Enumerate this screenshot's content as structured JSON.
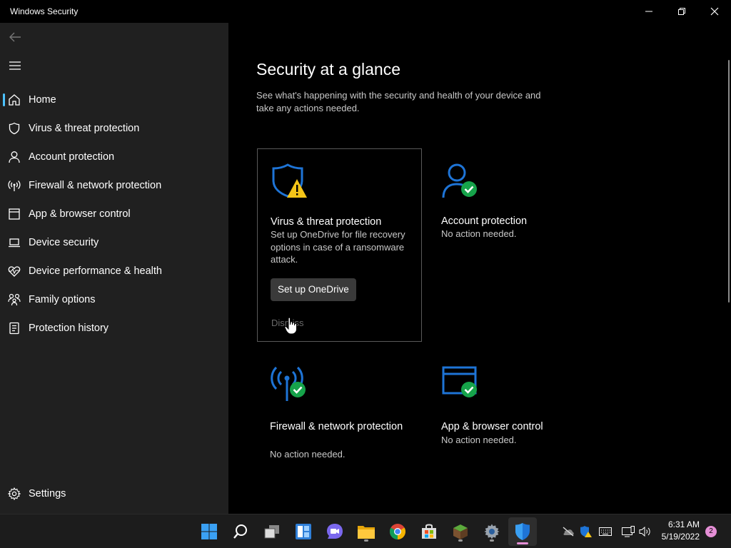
{
  "window": {
    "title": "Windows Security",
    "minimize_icon": "minimize-icon",
    "restore_icon": "restore-icon",
    "close_icon": "close-icon"
  },
  "sidebar": {
    "back_icon": "back-arrow-icon",
    "menu_icon": "hamburger-menu-icon",
    "items": [
      {
        "label": "Home",
        "icon": "home-icon",
        "active": true
      },
      {
        "label": "Virus & threat protection",
        "icon": "shield-icon"
      },
      {
        "label": "Account protection",
        "icon": "person-icon"
      },
      {
        "label": "Firewall & network protection",
        "icon": "wifi-antenna-icon"
      },
      {
        "label": "App & browser control",
        "icon": "browser-window-icon"
      },
      {
        "label": "Device security",
        "icon": "laptop-icon"
      },
      {
        "label": "Device performance & health",
        "icon": "heart-pulse-icon"
      },
      {
        "label": "Family options",
        "icon": "family-icon"
      },
      {
        "label": "Protection history",
        "icon": "history-icon"
      }
    ],
    "settings": {
      "label": "Settings",
      "icon": "gear-icon"
    }
  },
  "main": {
    "title": "Security at a glance",
    "subtitle": "See what's happening with the security and health of your device and take any actions needed.",
    "cards": [
      {
        "title": "Virus & threat protection",
        "description": "Set up OneDrive for file recovery options in case of a ransomware attack.",
        "button": "Set up OneDrive",
        "dismiss": "Dismiss",
        "icon": "shield-warning-icon",
        "status": "warning"
      },
      {
        "title": "Account protection",
        "description": "No action needed.",
        "icon": "person-check-icon",
        "status": "ok"
      },
      {
        "title": "Firewall & network protection",
        "description": "No action needed.",
        "icon": "antenna-check-icon",
        "status": "ok"
      },
      {
        "title": "App & browser control",
        "description": "No action needed.",
        "icon": "browser-check-icon",
        "status": "ok"
      }
    ]
  },
  "taskbar": {
    "apps": [
      {
        "name": "start-icon"
      },
      {
        "name": "search-icon"
      },
      {
        "name": "task-view-icon"
      },
      {
        "name": "widgets-icon"
      },
      {
        "name": "teams-chat-icon"
      },
      {
        "name": "file-explorer-icon"
      },
      {
        "name": "chrome-icon"
      },
      {
        "name": "microsoft-store-icon"
      },
      {
        "name": "minecraft-icon"
      },
      {
        "name": "settings-icon"
      },
      {
        "name": "windows-security-icon"
      }
    ],
    "tray": [
      "onedrive-offline-icon",
      "security-tray-icon",
      "keyboard-icon",
      "network-icon",
      "volume-icon"
    ],
    "time": "6:31 AM",
    "date": "5/19/2022",
    "notifications": "2"
  },
  "colors": {
    "accent": "#4cc2ff",
    "icon_blue": "#1e74d6",
    "ok_green": "#16a34a",
    "warning_yellow": "#f5c518"
  }
}
